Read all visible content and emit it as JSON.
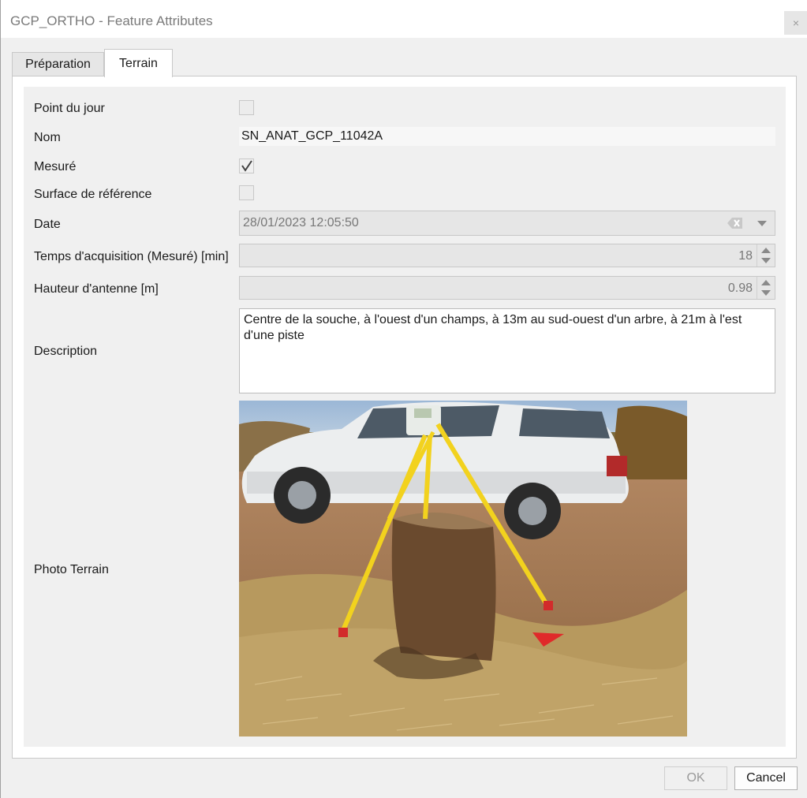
{
  "window": {
    "title": "GCP_ORTHO - Feature Attributes",
    "close_glyph": "×"
  },
  "tabs": [
    {
      "label": "Préparation",
      "active": false
    },
    {
      "label": "Terrain",
      "active": true
    }
  ],
  "fields": {
    "point_du_jour": {
      "label": "Point du jour",
      "checked": false
    },
    "nom": {
      "label": "Nom",
      "value": "SN_ANAT_GCP_11042A"
    },
    "mesure": {
      "label": "Mesuré",
      "checked": true
    },
    "surface_reference": {
      "label": "Surface de référence",
      "checked": false
    },
    "date": {
      "label": "Date",
      "value": "28/01/2023 12:05:50"
    },
    "temps_acquisition": {
      "label": "Temps d'acquisition (Mesuré) [min]",
      "value": "18"
    },
    "hauteur_antenne": {
      "label": "Hauteur d'antenne [m]",
      "value": "0.98"
    },
    "description": {
      "label": "Description",
      "value": "Centre de la souche, à l'ouest d'un champs, à 13m au sud-ouest d'un arbre, à 21m à l'est d'une piste"
    },
    "photo_terrain": {
      "label": "Photo Terrain"
    }
  },
  "buttons": {
    "ok": "OK",
    "cancel": "Cancel"
  },
  "colors": {
    "window_bg": "#f0f0f0",
    "panel_bg": "#ffffff",
    "disabled_text": "#787878"
  }
}
